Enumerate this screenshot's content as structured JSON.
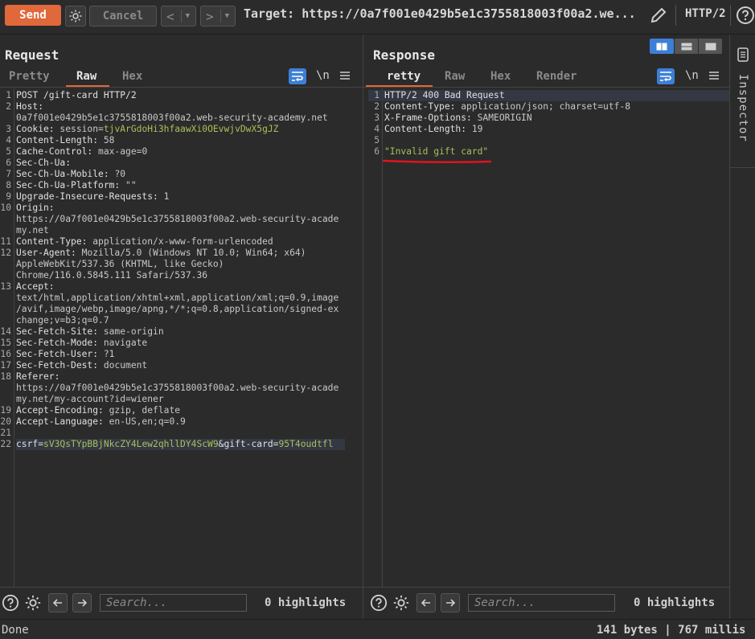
{
  "toolbar": {
    "send_label": "Send",
    "cancel_label": "Cancel",
    "back_icon": "<",
    "forward_icon": ">",
    "target_text": "Target: https://0a7f001e0429b5e1c3755818003f00a2.we...",
    "protocol_label": "HTTP/2"
  },
  "request": {
    "title": "Request",
    "tabs": [
      "Pretty",
      "Raw",
      "Hex"
    ],
    "active_tab": "Raw",
    "newline_toggle": "\\n",
    "lines": [
      {
        "n": "1",
        "parts": [
          [
            "t",
            "POST /gift-card HTTP/2"
          ]
        ]
      },
      {
        "n": "2",
        "parts": [
          [
            "h",
            "Host:"
          ]
        ]
      },
      {
        "n": "",
        "parts": [
          [
            "v",
            "0a7f001e0429b5e1c3755818003f00a2.web-security-academy.net"
          ]
        ]
      },
      {
        "n": "3",
        "parts": [
          [
            "h",
            "Cookie: "
          ],
          [
            "v",
            "session="
          ],
          [
            "g",
            "tjvArGdoHi3hfaawXi0OEvwjvDwX5gJZ"
          ]
        ]
      },
      {
        "n": "4",
        "parts": [
          [
            "h",
            "Content-Length: "
          ],
          [
            "v",
            "58"
          ]
        ]
      },
      {
        "n": "5",
        "parts": [
          [
            "h",
            "Cache-Control: "
          ],
          [
            "v",
            "max-age=0"
          ]
        ]
      },
      {
        "n": "6",
        "parts": [
          [
            "h",
            "Sec-Ch-Ua:"
          ]
        ]
      },
      {
        "n": "7",
        "parts": [
          [
            "h",
            "Sec-Ch-Ua-Mobile: "
          ],
          [
            "v",
            "?0"
          ]
        ]
      },
      {
        "n": "8",
        "parts": [
          [
            "h",
            "Sec-Ch-Ua-Platform: "
          ],
          [
            "v",
            "\"\""
          ]
        ]
      },
      {
        "n": "9",
        "parts": [
          [
            "h",
            "Upgrade-Insecure-Requests: "
          ],
          [
            "v",
            "1"
          ]
        ]
      },
      {
        "n": "10",
        "parts": [
          [
            "h",
            "Origin:"
          ]
        ]
      },
      {
        "n": "",
        "parts": [
          [
            "v",
            "https://0a7f001e0429b5e1c3755818003f00a2.web-security-acade"
          ]
        ]
      },
      {
        "n": "",
        "parts": [
          [
            "v",
            "my.net"
          ]
        ]
      },
      {
        "n": "11",
        "parts": [
          [
            "h",
            "Content-Type: "
          ],
          [
            "v",
            "application/x-www-form-urlencoded"
          ]
        ]
      },
      {
        "n": "12",
        "parts": [
          [
            "h",
            "User-Agent: "
          ],
          [
            "v",
            "Mozilla/5.0 (Windows NT 10.0; Win64; x64)"
          ]
        ]
      },
      {
        "n": "",
        "parts": [
          [
            "v",
            "AppleWebKit/537.36 (KHTML, like Gecko)"
          ]
        ]
      },
      {
        "n": "",
        "parts": [
          [
            "v",
            "Chrome/116.0.5845.111 Safari/537.36"
          ]
        ]
      },
      {
        "n": "13",
        "parts": [
          [
            "h",
            "Accept:"
          ]
        ]
      },
      {
        "n": "",
        "parts": [
          [
            "v",
            "text/html,application/xhtml+xml,application/xml;q=0.9,image"
          ]
        ]
      },
      {
        "n": "",
        "parts": [
          [
            "v",
            "/avif,image/webp,image/apng,*/*;q=0.8,application/signed-ex"
          ]
        ]
      },
      {
        "n": "",
        "parts": [
          [
            "v",
            "change;v=b3;q=0.7"
          ]
        ]
      },
      {
        "n": "14",
        "parts": [
          [
            "h",
            "Sec-Fetch-Site: "
          ],
          [
            "v",
            "same-origin"
          ]
        ]
      },
      {
        "n": "15",
        "parts": [
          [
            "h",
            "Sec-Fetch-Mode: "
          ],
          [
            "v",
            "navigate"
          ]
        ]
      },
      {
        "n": "16",
        "parts": [
          [
            "h",
            "Sec-Fetch-User: "
          ],
          [
            "v",
            "?1"
          ]
        ]
      },
      {
        "n": "17",
        "parts": [
          [
            "h",
            "Sec-Fetch-Dest: "
          ],
          [
            "v",
            "document"
          ]
        ]
      },
      {
        "n": "18",
        "parts": [
          [
            "h",
            "Referer:"
          ]
        ]
      },
      {
        "n": "",
        "parts": [
          [
            "v",
            "https://0a7f001e0429b5e1c3755818003f00a2.web-security-acade"
          ]
        ]
      },
      {
        "n": "",
        "parts": [
          [
            "v",
            "my.net/my-account?id=wiener"
          ]
        ]
      },
      {
        "n": "19",
        "parts": [
          [
            "h",
            "Accept-Encoding: "
          ],
          [
            "v",
            "gzip, deflate"
          ]
        ]
      },
      {
        "n": "20",
        "parts": [
          [
            "h",
            "Accept-Language: "
          ],
          [
            "v",
            "en-US,en;q=0.9"
          ]
        ]
      },
      {
        "n": "21",
        "parts": []
      },
      {
        "n": "22",
        "parts": [
          [
            "h",
            "csrf="
          ],
          [
            "g",
            "sV3QsTYpBBjNkcZY4Lew2qhllDY4ScW9"
          ],
          [
            "h",
            "&gift-card="
          ],
          [
            "g",
            "95T4oudtfl"
          ]
        ]
      }
    ],
    "search_placeholder": "Search...",
    "highlights": "0 highlights"
  },
  "response": {
    "title": "Response",
    "tabs": [
      "Pretty",
      "Raw",
      "Hex",
      "Render"
    ],
    "pretty_visible": "retty",
    "active_tab": "Pretty",
    "newline_toggle": "\\n",
    "lines": [
      {
        "n": "1",
        "parts": [
          [
            "t",
            "HTTP/2 400 Bad Request"
          ]
        ]
      },
      {
        "n": "2",
        "parts": [
          [
            "h",
            "Content-Type: "
          ],
          [
            "v",
            "application/json; charset=utf-8"
          ]
        ]
      },
      {
        "n": "3",
        "parts": [
          [
            "h",
            "X-Frame-Options: "
          ],
          [
            "v",
            "SAMEORIGIN"
          ]
        ]
      },
      {
        "n": "4",
        "parts": [
          [
            "h",
            "Content-Length: "
          ],
          [
            "v",
            "19"
          ]
        ]
      },
      {
        "n": "5",
        "parts": []
      },
      {
        "n": "6",
        "parts": [
          [
            "g",
            "\"Invalid gift card\""
          ]
        ]
      }
    ],
    "search_placeholder": "Search...",
    "highlights": "0 highlights"
  },
  "inspector": {
    "label": "Inspector"
  },
  "status": {
    "left": "Done",
    "right": "141 bytes | 767 millis"
  },
  "colors": {
    "accent": "#e0683a",
    "blue": "#3d7fd6",
    "annotation_red": "#e0141e",
    "value_green": "#a8c05c"
  }
}
